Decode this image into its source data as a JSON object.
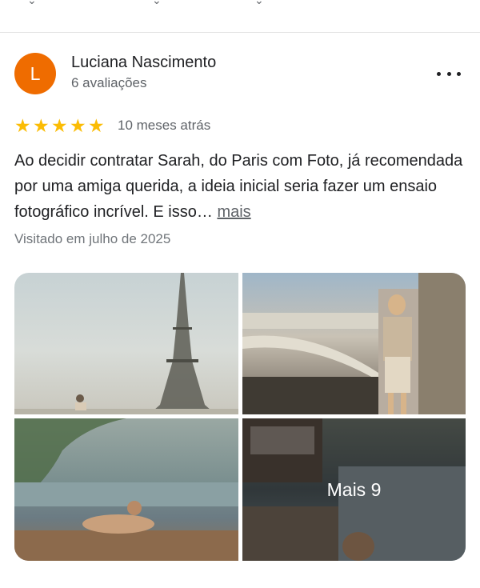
{
  "review": {
    "avatar_letter": "L",
    "author": "Luciana Nascimento",
    "reviews_count": "6 avaliações",
    "rating": 5,
    "rating_max": 5,
    "time_ago": "10 meses atrás",
    "text": "Ao decidir contratar Sarah, do Paris com Foto, já recomendada por uma amiga querida, a ideia inicial seria fazer um ensaio fotográfico incrível. E isso…",
    "more_label": "mais",
    "visited": "Visitado em julho de 2025"
  },
  "photos": {
    "more_label": "Mais 9"
  },
  "colors": {
    "avatar": "#ef6c00",
    "star": "#fbbc04",
    "text_primary": "#202124",
    "text_secondary": "#5f6368"
  },
  "icons": {
    "more": "more-vert-icon",
    "star": "star-icon"
  }
}
